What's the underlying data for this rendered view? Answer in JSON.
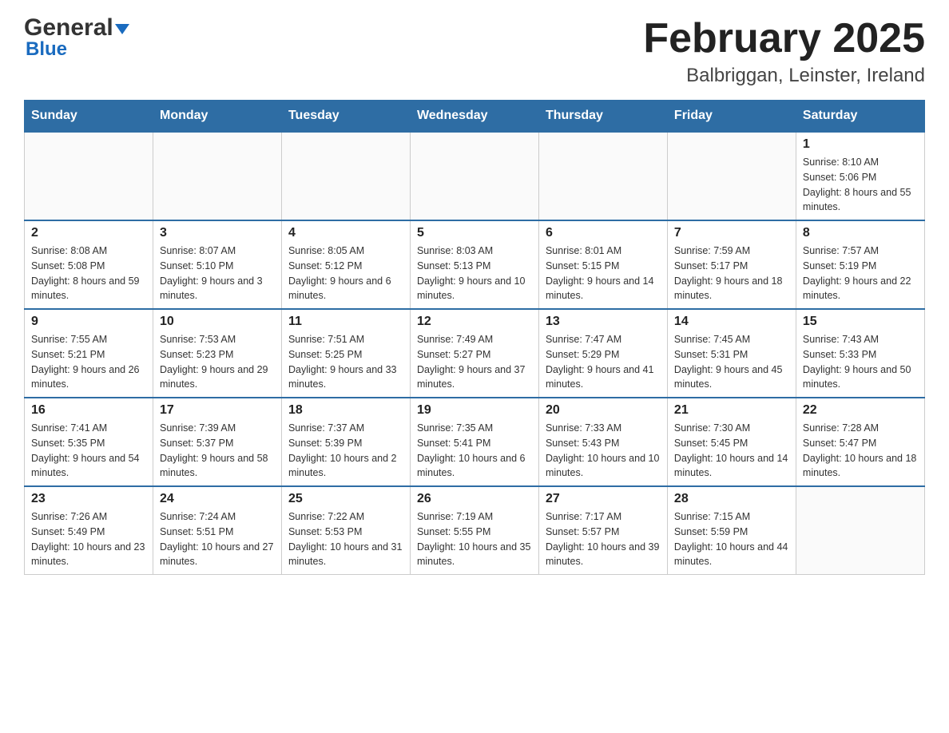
{
  "header": {
    "logo_general": "General",
    "logo_blue": "Blue",
    "month_title": "February 2025",
    "location": "Balbriggan, Leinster, Ireland"
  },
  "days_of_week": [
    "Sunday",
    "Monday",
    "Tuesday",
    "Wednesday",
    "Thursday",
    "Friday",
    "Saturday"
  ],
  "weeks": [
    [
      {
        "day": "",
        "info": ""
      },
      {
        "day": "",
        "info": ""
      },
      {
        "day": "",
        "info": ""
      },
      {
        "day": "",
        "info": ""
      },
      {
        "day": "",
        "info": ""
      },
      {
        "day": "",
        "info": ""
      },
      {
        "day": "1",
        "info": "Sunrise: 8:10 AM\nSunset: 5:06 PM\nDaylight: 8 hours and 55 minutes."
      }
    ],
    [
      {
        "day": "2",
        "info": "Sunrise: 8:08 AM\nSunset: 5:08 PM\nDaylight: 8 hours and 59 minutes."
      },
      {
        "day": "3",
        "info": "Sunrise: 8:07 AM\nSunset: 5:10 PM\nDaylight: 9 hours and 3 minutes."
      },
      {
        "day": "4",
        "info": "Sunrise: 8:05 AM\nSunset: 5:12 PM\nDaylight: 9 hours and 6 minutes."
      },
      {
        "day": "5",
        "info": "Sunrise: 8:03 AM\nSunset: 5:13 PM\nDaylight: 9 hours and 10 minutes."
      },
      {
        "day": "6",
        "info": "Sunrise: 8:01 AM\nSunset: 5:15 PM\nDaylight: 9 hours and 14 minutes."
      },
      {
        "day": "7",
        "info": "Sunrise: 7:59 AM\nSunset: 5:17 PM\nDaylight: 9 hours and 18 minutes."
      },
      {
        "day": "8",
        "info": "Sunrise: 7:57 AM\nSunset: 5:19 PM\nDaylight: 9 hours and 22 minutes."
      }
    ],
    [
      {
        "day": "9",
        "info": "Sunrise: 7:55 AM\nSunset: 5:21 PM\nDaylight: 9 hours and 26 minutes."
      },
      {
        "day": "10",
        "info": "Sunrise: 7:53 AM\nSunset: 5:23 PM\nDaylight: 9 hours and 29 minutes."
      },
      {
        "day": "11",
        "info": "Sunrise: 7:51 AM\nSunset: 5:25 PM\nDaylight: 9 hours and 33 minutes."
      },
      {
        "day": "12",
        "info": "Sunrise: 7:49 AM\nSunset: 5:27 PM\nDaylight: 9 hours and 37 minutes."
      },
      {
        "day": "13",
        "info": "Sunrise: 7:47 AM\nSunset: 5:29 PM\nDaylight: 9 hours and 41 minutes."
      },
      {
        "day": "14",
        "info": "Sunrise: 7:45 AM\nSunset: 5:31 PM\nDaylight: 9 hours and 45 minutes."
      },
      {
        "day": "15",
        "info": "Sunrise: 7:43 AM\nSunset: 5:33 PM\nDaylight: 9 hours and 50 minutes."
      }
    ],
    [
      {
        "day": "16",
        "info": "Sunrise: 7:41 AM\nSunset: 5:35 PM\nDaylight: 9 hours and 54 minutes."
      },
      {
        "day": "17",
        "info": "Sunrise: 7:39 AM\nSunset: 5:37 PM\nDaylight: 9 hours and 58 minutes."
      },
      {
        "day": "18",
        "info": "Sunrise: 7:37 AM\nSunset: 5:39 PM\nDaylight: 10 hours and 2 minutes."
      },
      {
        "day": "19",
        "info": "Sunrise: 7:35 AM\nSunset: 5:41 PM\nDaylight: 10 hours and 6 minutes."
      },
      {
        "day": "20",
        "info": "Sunrise: 7:33 AM\nSunset: 5:43 PM\nDaylight: 10 hours and 10 minutes."
      },
      {
        "day": "21",
        "info": "Sunrise: 7:30 AM\nSunset: 5:45 PM\nDaylight: 10 hours and 14 minutes."
      },
      {
        "day": "22",
        "info": "Sunrise: 7:28 AM\nSunset: 5:47 PM\nDaylight: 10 hours and 18 minutes."
      }
    ],
    [
      {
        "day": "23",
        "info": "Sunrise: 7:26 AM\nSunset: 5:49 PM\nDaylight: 10 hours and 23 minutes."
      },
      {
        "day": "24",
        "info": "Sunrise: 7:24 AM\nSunset: 5:51 PM\nDaylight: 10 hours and 27 minutes."
      },
      {
        "day": "25",
        "info": "Sunrise: 7:22 AM\nSunset: 5:53 PM\nDaylight: 10 hours and 31 minutes."
      },
      {
        "day": "26",
        "info": "Sunrise: 7:19 AM\nSunset: 5:55 PM\nDaylight: 10 hours and 35 minutes."
      },
      {
        "day": "27",
        "info": "Sunrise: 7:17 AM\nSunset: 5:57 PM\nDaylight: 10 hours and 39 minutes."
      },
      {
        "day": "28",
        "info": "Sunrise: 7:15 AM\nSunset: 5:59 PM\nDaylight: 10 hours and 44 minutes."
      },
      {
        "day": "",
        "info": ""
      }
    ]
  ]
}
